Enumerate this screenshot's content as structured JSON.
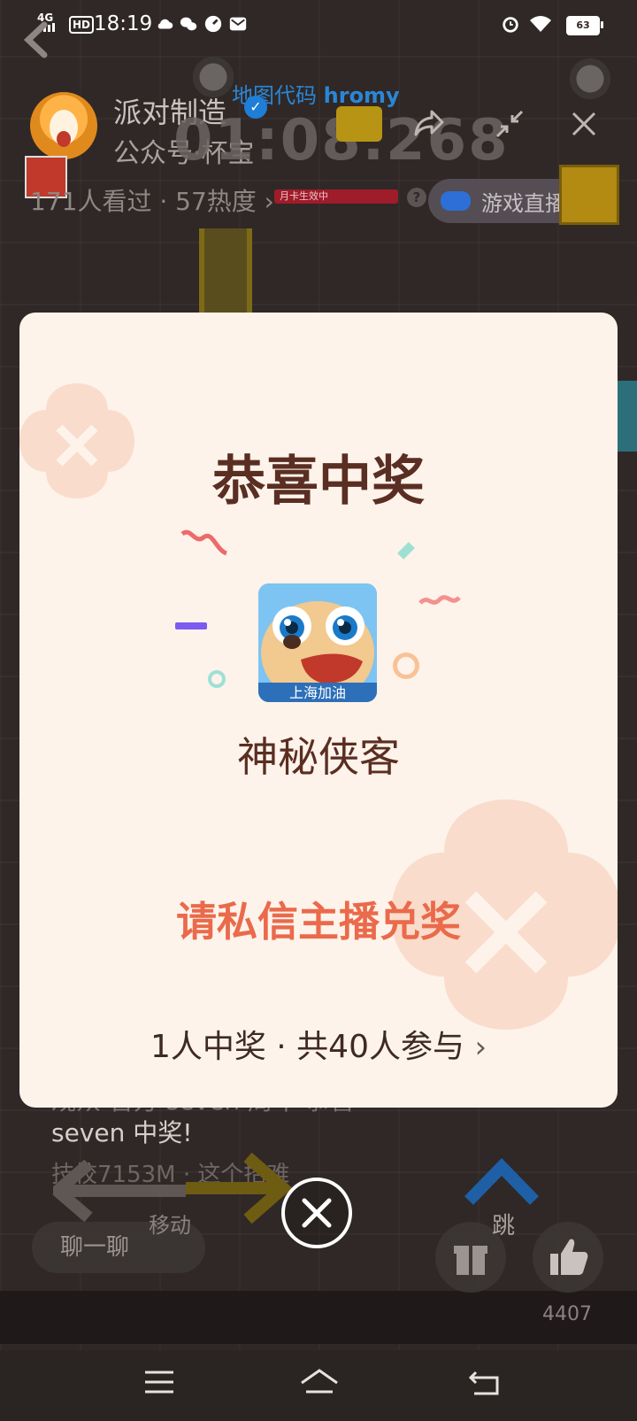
{
  "status_bar": {
    "network": "4G",
    "hd": "HD",
    "time": "18:19",
    "battery": "63"
  },
  "stream_header": {
    "anchor_name": "派对制造",
    "anchor_sub": "公众号·杯宝",
    "map_code_label": "地图代码",
    "map_code_value": "hromy",
    "timer": "01:08.268",
    "viewers": "171人看过 · 57热度",
    "heat_strip_text": "月卡生效中",
    "game_live_label": "游戏直播"
  },
  "modal": {
    "title": "恭喜中奖",
    "prize_name": "神秘侠客",
    "prize_image_caption": "上海加油",
    "redeem_hint": "请私信主播兑奖",
    "winners_summary": "1人中奖 · 共40人参与",
    "winners_chevron": "›"
  },
  "bottom_overlay": {
    "chat_line_1": "观众 官方 seven 周年 恭喜",
    "chat_line_2": "seven 中奖!",
    "chat_line_3": "技校7153M · 这个招难",
    "chat_button": "聊一聊",
    "move_label": "移动",
    "jump_label": "跳",
    "like_count": "4407"
  },
  "icons": {
    "back": "back-arrow-icon",
    "share": "share-icon",
    "shrink": "shrink-icon",
    "close": "close-icon",
    "gift": "gift-icon",
    "like": "thumbs-up-icon",
    "dismiss": "close-circle-icon"
  },
  "colors": {
    "modal_bg": "#fdf3ea",
    "title": "#5a2e22",
    "redeem": "#ea6a4b",
    "verified": "#1e7ed8"
  }
}
